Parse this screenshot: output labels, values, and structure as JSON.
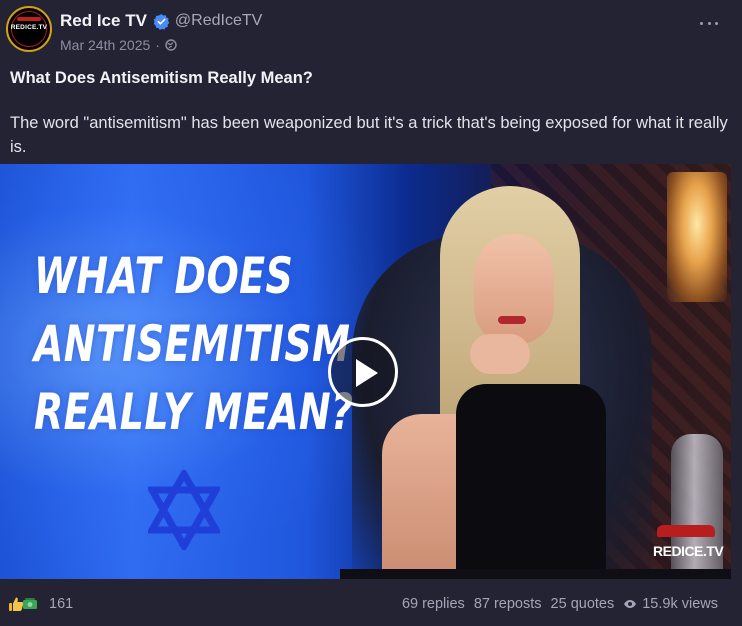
{
  "post": {
    "author": {
      "display_name": "Red Ice TV",
      "handle": "@RedIceTV",
      "verified": true,
      "avatar_text": "REDICE.TV"
    },
    "meta": {
      "date": "Mar 24th 2025",
      "separator": "·",
      "visibility_icon": "globe-icon"
    },
    "title": "What Does Antisemitism Really Mean?",
    "body": "The word \"antisemitism\" has been weaponized but it's a trick that's being exposed for what it really is.",
    "media": {
      "type": "video",
      "thumbnail_lines": [
        "WHAT DOES",
        "ANTISEMITISM",
        "REALLY MEAN?"
      ],
      "watermark": "REDICE.TV",
      "play_icon": "play-icon"
    },
    "reactions": {
      "icons": [
        "thumbs-up-icon",
        "money-icon"
      ],
      "count": "161"
    },
    "stats": {
      "replies": "69 replies",
      "reposts": "87 reposts",
      "quotes": "25 quotes",
      "views": "15.9k views"
    }
  },
  "colors": {
    "background": "#232334",
    "verified": "#4a8cf7",
    "thumbnail_blue": "#1f56dc",
    "brand_red": "#b81e1e"
  }
}
